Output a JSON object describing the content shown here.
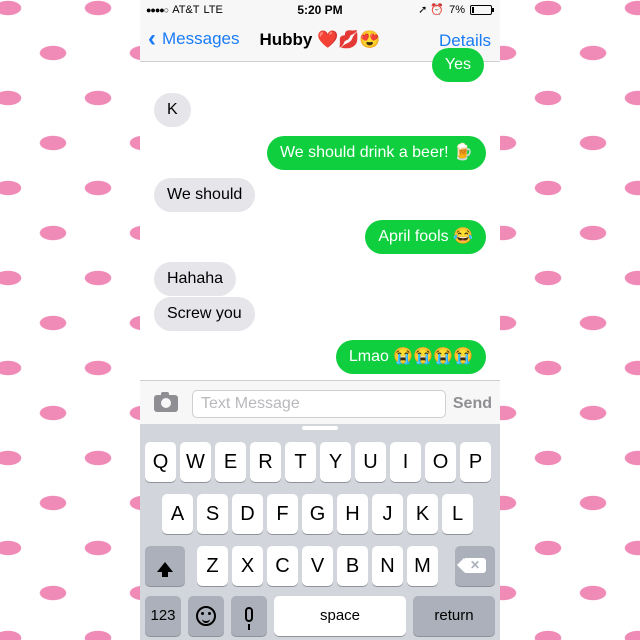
{
  "status_bar": {
    "signal": "●●●●○",
    "carrier": "AT&T",
    "network": "LTE",
    "time": "5:20 PM",
    "status_icons": "➚ ⏰",
    "battery": "7%"
  },
  "nav": {
    "back_label": "Messages",
    "title": "Hubby ❤️💋😍",
    "details_label": "Details"
  },
  "messages": [
    {
      "direction": "out",
      "text": "Yes"
    },
    {
      "direction": "in",
      "text": "K"
    },
    {
      "direction": "out",
      "text": "We should drink a beer! 🍺"
    },
    {
      "direction": "in",
      "text": "We should"
    },
    {
      "direction": "out",
      "text": "April fools 😂"
    },
    {
      "direction": "in",
      "text": "Hahaha"
    },
    {
      "direction": "in",
      "text": "Screw you"
    },
    {
      "direction": "out",
      "text": "Lmao 😭😭😭😭"
    }
  ],
  "input": {
    "placeholder": "Text Message",
    "value": "",
    "send_label": "Send"
  },
  "keyboard": {
    "row1": [
      "Q",
      "W",
      "E",
      "R",
      "T",
      "Y",
      "U",
      "I",
      "O",
      "P"
    ],
    "row2": [
      "A",
      "S",
      "D",
      "F",
      "G",
      "H",
      "J",
      "K",
      "L"
    ],
    "row3": [
      "Z",
      "X",
      "C",
      "V",
      "B",
      "N",
      "M"
    ],
    "numbers_label": "123",
    "space_label": "space",
    "return_label": "return"
  },
  "colors": {
    "outgoing_bubble": "#0fcf3e",
    "incoming_bubble": "#e5e5ea",
    "accent": "#1a7cf5",
    "background_pattern": "#f08bb8"
  },
  "icons": {
    "back": "chevron-left-icon",
    "camera": "camera-icon",
    "shift": "shift-icon",
    "delete": "delete-icon",
    "emoji": "emoji-icon",
    "mic": "microphone-icon"
  }
}
